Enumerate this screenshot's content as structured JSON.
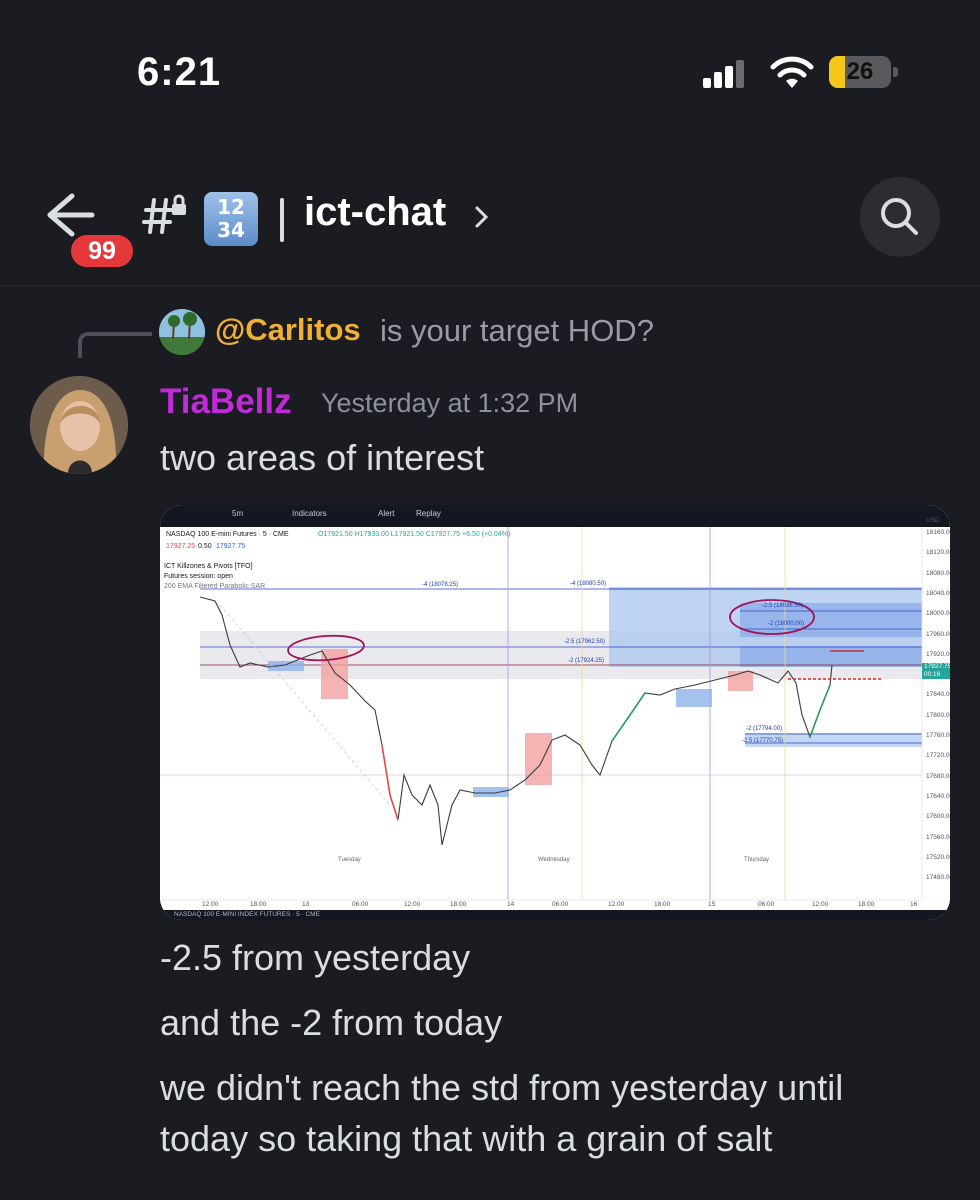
{
  "status_bar": {
    "time": "6:21",
    "battery_percent": "26",
    "battery_level": 0.26,
    "battery_color": "#f5c518"
  },
  "header": {
    "back_icon": "arrow-left-icon",
    "unread_count": "99",
    "thread_icon": "hashtag-lock-icon",
    "emoji_digits_top": "12",
    "emoji_digits_bottom": "34",
    "channel_name": "ict-chat",
    "search_icon": "magnifier-icon"
  },
  "reply": {
    "author": "@Carlitos",
    "text": "is your target HOD?",
    "author_color": "#f0b132"
  },
  "message": {
    "author": "TiaBellz",
    "author_color": "#c12ad8",
    "timestamp": "Yesterday at 1:32 PM",
    "lines": [
      "two areas of interest",
      "-2.5 from yesterday",
      "and the -2 from today",
      "we didn't reach the std from yesterday until",
      "today so taking that with a grain of salt"
    ]
  },
  "chart": {
    "toolbar": {
      "timeframe": "5m",
      "indicators": "Indicators",
      "alert": "Alert",
      "replay": "Replay"
    },
    "legend": {
      "symbol_line": "NASDAQ 100 E-mini Futures · 5 · CME",
      "ohlc": "O17921.50 H17933.00 L17921.50 C17927.75 +6.50 (+0.04%)",
      "bid": "17927.25",
      "spread": "0.50",
      "ask": "17927.75",
      "indicator_1": "ICT Killzones & Pivots [TFO]",
      "indicator_2": "Futures session: open",
      "indicator_3": "200 EMA Filtered Parabolic SAR"
    },
    "levels": {
      "l1": "-4 (18078.25)",
      "l2": "-4 (18080.50)",
      "l3": "-2.5 (18036.50)",
      "l4": "-2 (18000.00)",
      "l5": "-2.5 (17962.50)",
      "l6": "-2 (17924.25)",
      "l7": "-2 (17794.00)",
      "l8": "-2.5 (17770.75)"
    },
    "price_axis": [
      "USD",
      "18160.00",
      "18120.00",
      "18080.00",
      "18040.00",
      "18000.00",
      "17960.00",
      "17920.00",
      "17880.00",
      "17840.00",
      "17800.00",
      "17760.00",
      "17720.00",
      "17680.00",
      "17640.00",
      "17600.00",
      "17560.00",
      "17520.00",
      "17480.00"
    ],
    "current_price": "17927.75",
    "current_countdown": "00:16",
    "time_axis": [
      "12:00",
      "18:00",
      "13",
      "06:00",
      "12:00",
      "18:00",
      "14",
      "06:00",
      "12:00",
      "18:00",
      "15",
      "06:00",
      "12:00",
      "18:00",
      "16"
    ],
    "day_labels": [
      "Tuesday",
      "Wednesday",
      "Thursday"
    ],
    "bottom_text": "NASDAQ 100 E-MINI INDEX FUTURES · 5 · CME"
  }
}
